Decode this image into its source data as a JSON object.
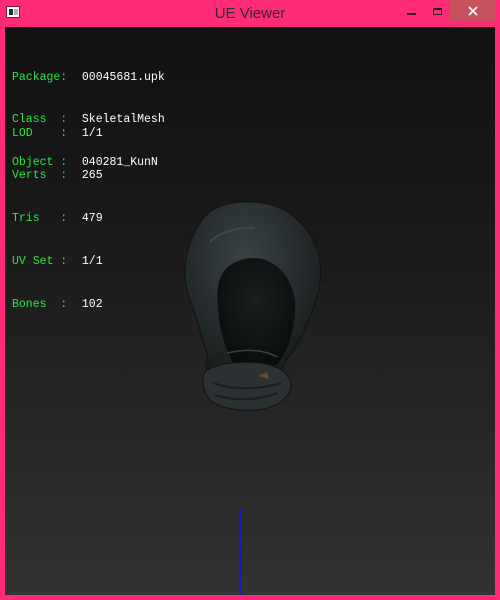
{
  "window": {
    "title": "UE Viewer",
    "icon": "app-icon",
    "controls": [
      "minimize-icon",
      "maximize-icon",
      "close-icon"
    ]
  },
  "info": {
    "package": {
      "label": "Package:",
      "value": "00045681.upk"
    },
    "class": {
      "label": "Class  :",
      "value": "SkeletalMesh"
    },
    "object": {
      "label": "Object :",
      "value": "040281_KunN"
    },
    "lod": {
      "label": "LOD    :",
      "value": "1/1"
    },
    "verts": {
      "label": "Verts  :",
      "value": "265"
    },
    "tris": {
      "label": "Tris   :",
      "value": "479"
    },
    "uvset": {
      "label": "UV Set :",
      "value": "1/1"
    },
    "bones": {
      "label": "Bones  :",
      "value": "102"
    }
  },
  "colors": {
    "frame": "#ff2a78",
    "info_label": "#26e83e",
    "info_value": "#ffffff",
    "axis": "#1520b0"
  }
}
